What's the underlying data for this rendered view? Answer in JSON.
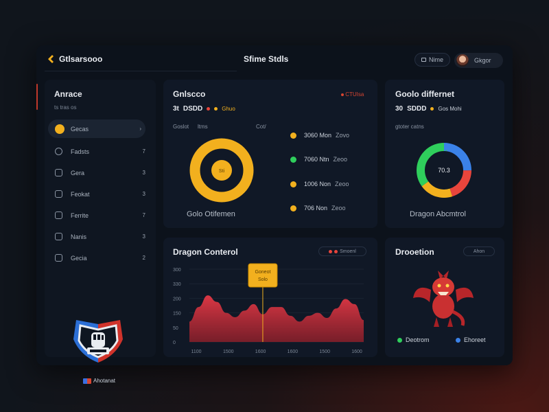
{
  "header": {
    "app_name": "Gtlsarsooo",
    "window_title": "Sfime Stdls",
    "chip_label": "Nime",
    "user_name": "Gkgor"
  },
  "sidebar": {
    "title": "Anrace",
    "subtitle": "ts tras os",
    "items": [
      {
        "label": "Gecas",
        "count": "",
        "active": true
      },
      {
        "label": "Fadsts",
        "count": "7"
      },
      {
        "label": "Gera",
        "count": "3"
      },
      {
        "label": "Feokat",
        "count": "3"
      },
      {
        "label": "Ferrite",
        "count": "7"
      },
      {
        "label": "Nanis",
        "count": "3"
      },
      {
        "label": "Gecia",
        "count": "2"
      }
    ],
    "footer_label": "Ahotanat"
  },
  "goals_card": {
    "title": "Gnlscco",
    "badge": "CTUIsa",
    "value": "3t",
    "value_label": "DSDD",
    "tag": "Ghuo",
    "sublabel_left": "Goslot",
    "sublabel_mid": "ltms",
    "sublabel_right": "Cot/",
    "ring_center": "Sti",
    "caption": "Golo Otifemen",
    "legend": [
      {
        "label": "3060 Mon",
        "value": "Zovo",
        "color": "#f2b01e"
      },
      {
        "label": "7060 Ntn",
        "value": "Zeoo",
        "color": "#2fce5c"
      },
      {
        "label": "1006 Non",
        "value": "Zeoo",
        "color": "#f2b01e"
      },
      {
        "label": "706 Non",
        "value": "Zeoo",
        "color": "#f2b01e"
      }
    ]
  },
  "difference_card": {
    "title": "Goolo differnet",
    "value": "30",
    "value_label": "SDDD",
    "tag": "Gos Mohi",
    "sublabel": "gtoter catns",
    "ring_center": "70.3",
    "caption": "Dragon Abcmtrol",
    "segments": [
      {
        "name": "blue",
        "value": 25,
        "color": "#3b82e8"
      },
      {
        "name": "red",
        "value": 20,
        "color": "#e8453c"
      },
      {
        "name": "yellow",
        "value": 20,
        "color": "#f2b01e"
      },
      {
        "name": "green",
        "value": 35,
        "color": "#2fce5c"
      }
    ]
  },
  "area_card": {
    "title": "Dragon Conterol",
    "pill_label": "Smoenl",
    "tooltip_line1": "Goneot",
    "tooltip_line2": "Solo"
  },
  "chart_data": {
    "type": "area",
    "y_ticks": [
      "300",
      "330",
      "200",
      "150",
      "50",
      "0"
    ],
    "x_ticks": [
      "1100",
      "1500",
      "1600",
      "1600",
      "1500",
      "1600"
    ],
    "ylim": [
      0,
      100
    ],
    "values": [
      28,
      48,
      64,
      55,
      40,
      34,
      43,
      52,
      38,
      48,
      48,
      36,
      28,
      36,
      40,
      33,
      46,
      59,
      52,
      30
    ],
    "series_color": "#e63946",
    "marker_index": 8
  },
  "dragon_card": {
    "title": "Drooetion",
    "pill_label": "Ahon",
    "legend": [
      {
        "label": "Deotrom",
        "color": "#2fce5c"
      },
      {
        "label": "Ehoreet",
        "color": "#3b82e8"
      }
    ]
  }
}
